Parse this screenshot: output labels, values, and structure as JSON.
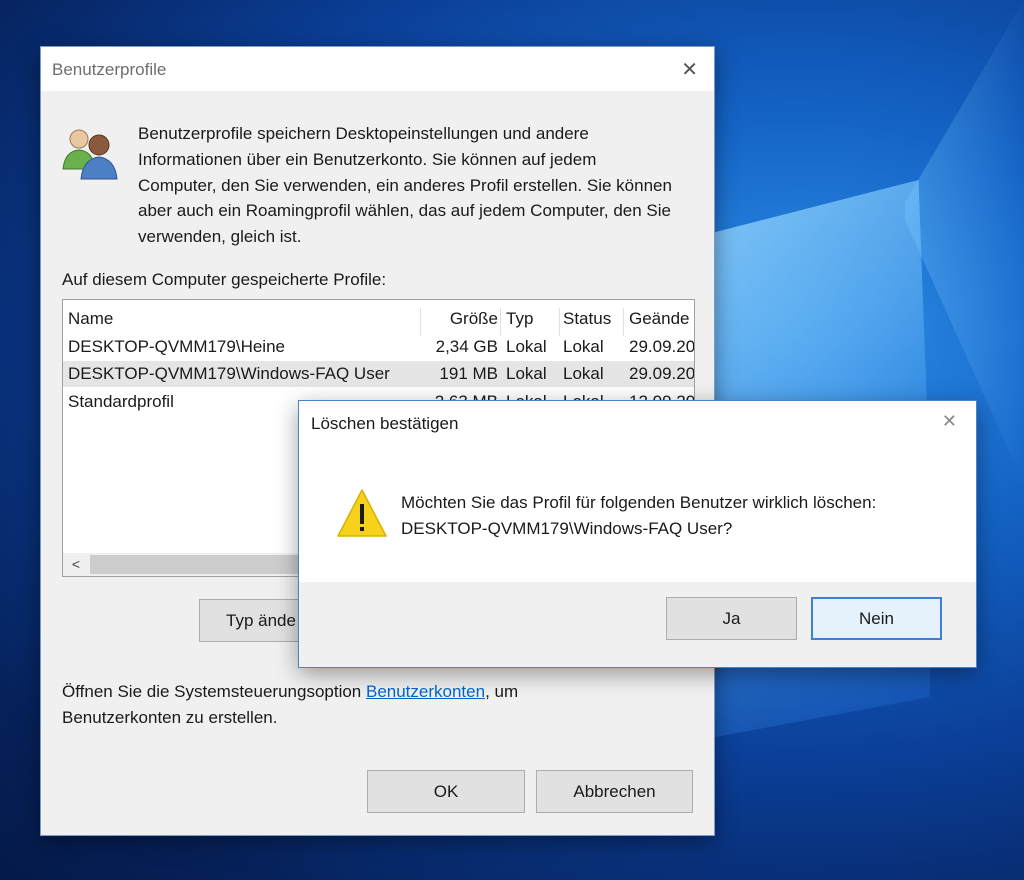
{
  "main_dialog": {
    "title": "Benutzerprofile",
    "close_label": "✕",
    "icon": "users-icon",
    "intro": "Benutzerprofile speichern Desktopeinstellungen und andere Informationen über ein Benutzerkonto. Sie können auf jedem Computer, den Sie verwenden, ein anderes Profil erstellen. Sie können aber auch ein Roamingprofil wählen, das auf jedem Computer, den Sie verwenden, gleich ist.",
    "stored_profiles_label": "Auf diesem Computer gespeicherte Profile:",
    "columns": [
      "Name",
      "Größe",
      "Typ",
      "Status",
      "Geände"
    ],
    "rows": [
      [
        "DESKTOP-QVMM179\\Heine",
        "2,34 GB",
        "Lokal",
        "Lokal",
        "29.09.20"
      ],
      [
        "DESKTOP-QVMM179\\Windows-FAQ User",
        "191 MB",
        "Lokal",
        "Lokal",
        "29.09.20"
      ],
      [
        "Standardprofil",
        "2,63 MB",
        "Lokal",
        "Lokal",
        "12.09.20"
      ]
    ],
    "selected_row": 1,
    "scroll_left_arrow": "<",
    "type_change_button": "Typ ände",
    "footer_prefix": "Öffnen Sie die Systemsteuerungsoption ",
    "footer_link": "Benutzerkonten",
    "footer_suffix": ", um Benutzerkonten zu erstellen.",
    "ok_button": "OK",
    "cancel_button": "Abbrechen"
  },
  "confirm_dialog": {
    "title": "Löschen bestätigen",
    "close_label": "✕",
    "icon": "warning-icon",
    "message_line1": "Möchten Sie das Profil für folgenden Benutzer wirklich löschen:",
    "message_line2": "DESKTOP-QVMM179\\Windows-FAQ User?",
    "yes_button": "Ja",
    "no_button": "Nein",
    "default_button": "Nein"
  },
  "colors": {
    "desktop_blue": "#0b3f98",
    "accent": "#3c7fd4",
    "link": "#0066cc",
    "warning_yellow": "#f7d21b"
  }
}
